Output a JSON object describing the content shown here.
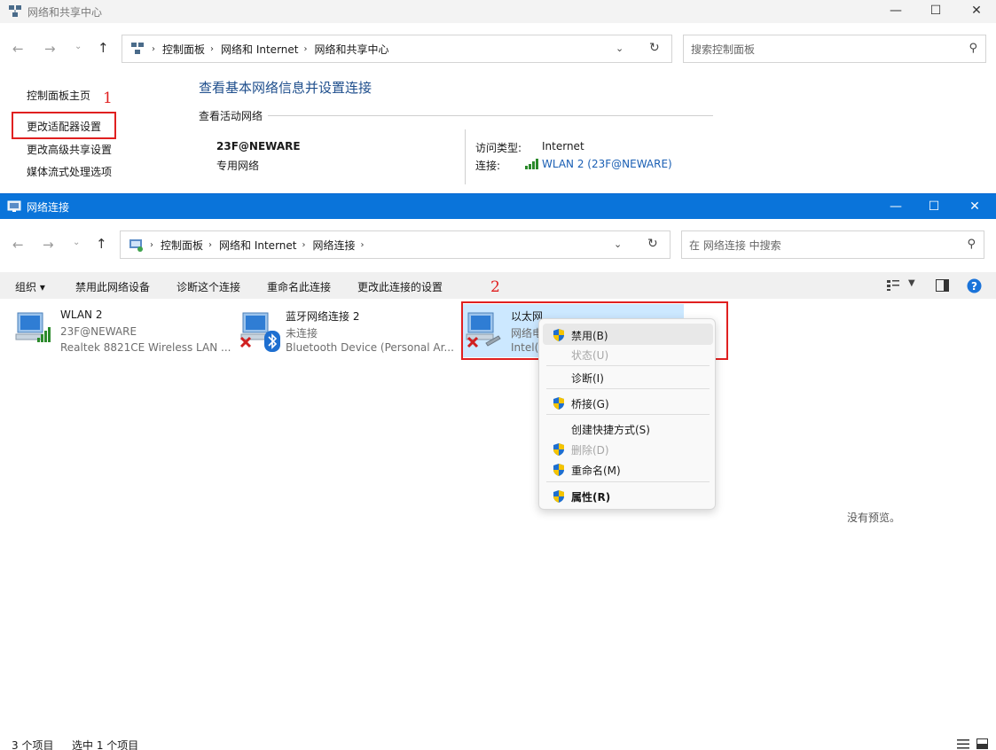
{
  "back_window": {
    "title": "网络和共享中心",
    "breadcrumbs": [
      "控制面板",
      "网络和 Internet",
      "网络和共享中心"
    ],
    "search_placeholder": "搜索控制面板",
    "sidebar": [
      {
        "label": "控制面板主页"
      },
      {
        "label": "更改适配器设置"
      },
      {
        "label": "更改高级共享设置"
      },
      {
        "label": "媒体流式处理选项"
      }
    ],
    "heading": "查看基本网络信息并设置连接",
    "section_label": "查看活动网络",
    "network_name": "23F@NEWARE",
    "network_type": "专用网络",
    "access_type_label": "访问类型:",
    "access_type_value": "Internet",
    "connection_label": "连接:",
    "connection_value": "WLAN 2 (23F@NEWARE)"
  },
  "annotations": {
    "marker1": "1",
    "marker2": "2"
  },
  "front_window": {
    "title": "网络连接",
    "breadcrumbs": [
      "控制面板",
      "网络和 Internet",
      "网络连接"
    ],
    "search_placeholder": "在 网络连接 中搜索",
    "commands": [
      "组织 ▾",
      "禁用此网络设备",
      "诊断这个连接",
      "重命名此连接",
      "更改此连接的设置"
    ],
    "connections": [
      {
        "name": "WLAN 2",
        "status": "23F@NEWARE",
        "device": "Realtek 8821CE Wireless LAN ..."
      },
      {
        "name": "蓝牙网络连接 2",
        "status": "未连接",
        "device": "Bluetooth Device (Personal Ar..."
      },
      {
        "name": "以太网",
        "status": "网络电",
        "device": "Intel("
      }
    ],
    "preview_text": "没有预览。",
    "status_items_count": "3 个项目",
    "status_selected": "选中 1 个项目"
  },
  "context_menu": {
    "items": [
      {
        "label": "禁用(B)",
        "shield": true,
        "disabled": false,
        "bold": false
      },
      {
        "label": "状态(U)",
        "shield": false,
        "disabled": true,
        "bold": false
      },
      {
        "label": "诊断(I)",
        "shield": false,
        "disabled": false,
        "bold": false
      },
      {
        "label": "桥接(G)",
        "shield": true,
        "disabled": false,
        "bold": false
      },
      {
        "label": "创建快捷方式(S)",
        "shield": false,
        "disabled": false,
        "bold": false
      },
      {
        "label": "删除(D)",
        "shield": true,
        "disabled": true,
        "bold": false
      },
      {
        "label": "重命名(M)",
        "shield": true,
        "disabled": false,
        "bold": false
      },
      {
        "label": "属性(R)",
        "shield": true,
        "disabled": false,
        "bold": true
      }
    ]
  },
  "colors": {
    "titlebar_active": "#0a74da",
    "link_blue": "#1a5fb4",
    "annotation_red": "#e02020",
    "selection": "#cce8ff"
  }
}
